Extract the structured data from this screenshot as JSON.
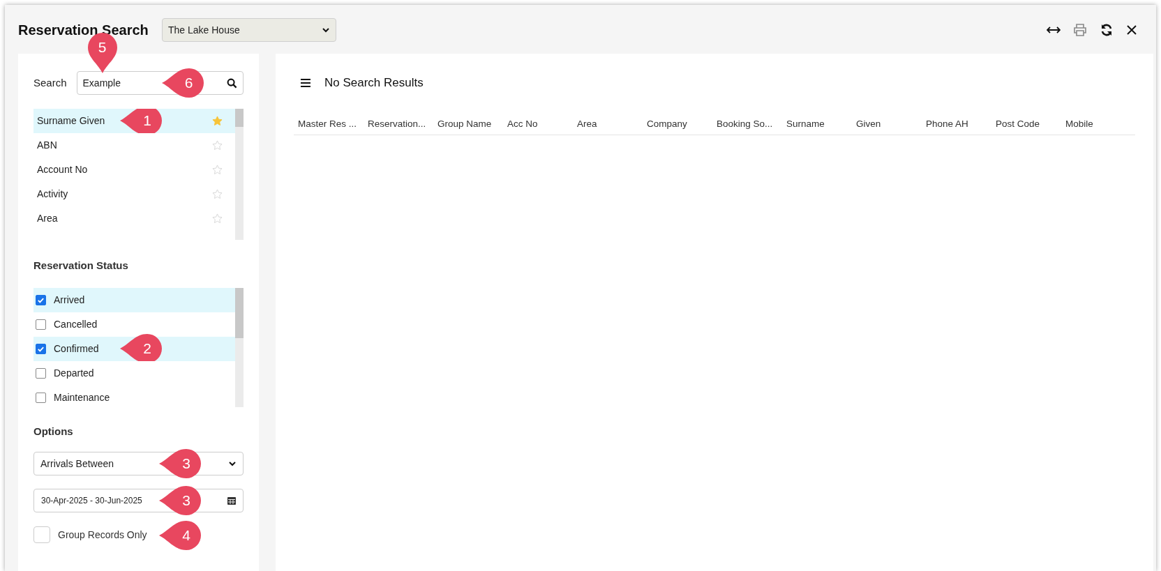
{
  "window": {
    "title": "Reservation Search",
    "property_select": {
      "value": "The Lake House"
    }
  },
  "search": {
    "label": "Search",
    "value": "Example",
    "callout": "5",
    "button_callout": "6"
  },
  "search_fields": [
    {
      "label": "Surname Given",
      "selected": true,
      "favorite": true,
      "callout": "1"
    },
    {
      "label": "ABN",
      "selected": false,
      "favorite": false
    },
    {
      "label": "Account No",
      "selected": false,
      "favorite": false
    },
    {
      "label": "Activity",
      "selected": false,
      "favorite": false
    },
    {
      "label": "Area",
      "selected": false,
      "favorite": false
    }
  ],
  "reservation_status": {
    "heading": "Reservation Status",
    "items": [
      {
        "label": "Arrived",
        "checked": true
      },
      {
        "label": "Cancelled",
        "checked": false
      },
      {
        "label": "Confirmed",
        "checked": true,
        "callout": "2"
      },
      {
        "label": "Departed",
        "checked": false
      },
      {
        "label": "Maintenance",
        "checked": false
      }
    ]
  },
  "options": {
    "heading": "Options",
    "date_type": {
      "value": "Arrivals Between",
      "callout": "3"
    },
    "date_range": {
      "value": "30-Apr-2025 - 30-Jun-2025",
      "callout": "3"
    },
    "group_records_only": {
      "label": "Group Records Only",
      "checked": false,
      "callout": "4"
    }
  },
  "results": {
    "title": "No Search Results",
    "columns": [
      "Master Res ...",
      "Reservation...",
      "Group Name",
      "Acc No",
      "Area",
      "Company",
      "Booking So...",
      "Surname",
      "Given",
      "Phone AH",
      "Post Code",
      "Mobile"
    ]
  }
}
